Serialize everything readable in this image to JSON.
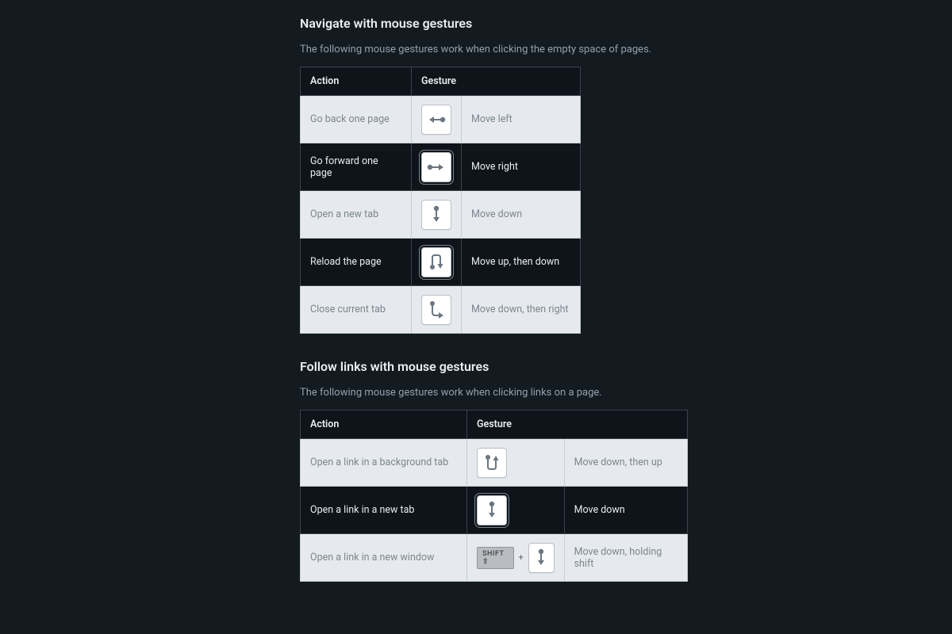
{
  "section1": {
    "title": "Navigate with mouse gestures",
    "lead": "The following mouse gestures work when clicking the empty space of pages.",
    "col_action": "Action",
    "col_gesture": "Gesture",
    "rows": [
      {
        "action": "Go back one page",
        "icon": "gesture-left",
        "gesture": "Move left"
      },
      {
        "action": "Go forward one page",
        "icon": "gesture-right",
        "gesture": "Move right"
      },
      {
        "action": "Open a new tab",
        "icon": "gesture-down",
        "gesture": "Move down"
      },
      {
        "action": "Reload the page",
        "icon": "gesture-up-down",
        "gesture": "Move up, then down"
      },
      {
        "action": "Close current tab",
        "icon": "gesture-down-right",
        "gesture": "Move down, then right"
      }
    ]
  },
  "section2": {
    "title": "Follow links with mouse gestures",
    "lead": "The following mouse gestures work when clicking links on a page.",
    "col_action": "Action",
    "col_gesture": "Gesture",
    "shift_label": "SHIFT ⇧",
    "plus": "+",
    "rows": [
      {
        "action": "Open a link in a background tab",
        "icon": "gesture-down-up",
        "gesture": "Move down, then up"
      },
      {
        "action": "Open a link in a new tab",
        "icon": "gesture-down",
        "gesture": "Move down"
      },
      {
        "action": "Open a link in a new window",
        "icon": "gesture-shift-down",
        "gesture": "Move down, holding shift"
      }
    ]
  }
}
